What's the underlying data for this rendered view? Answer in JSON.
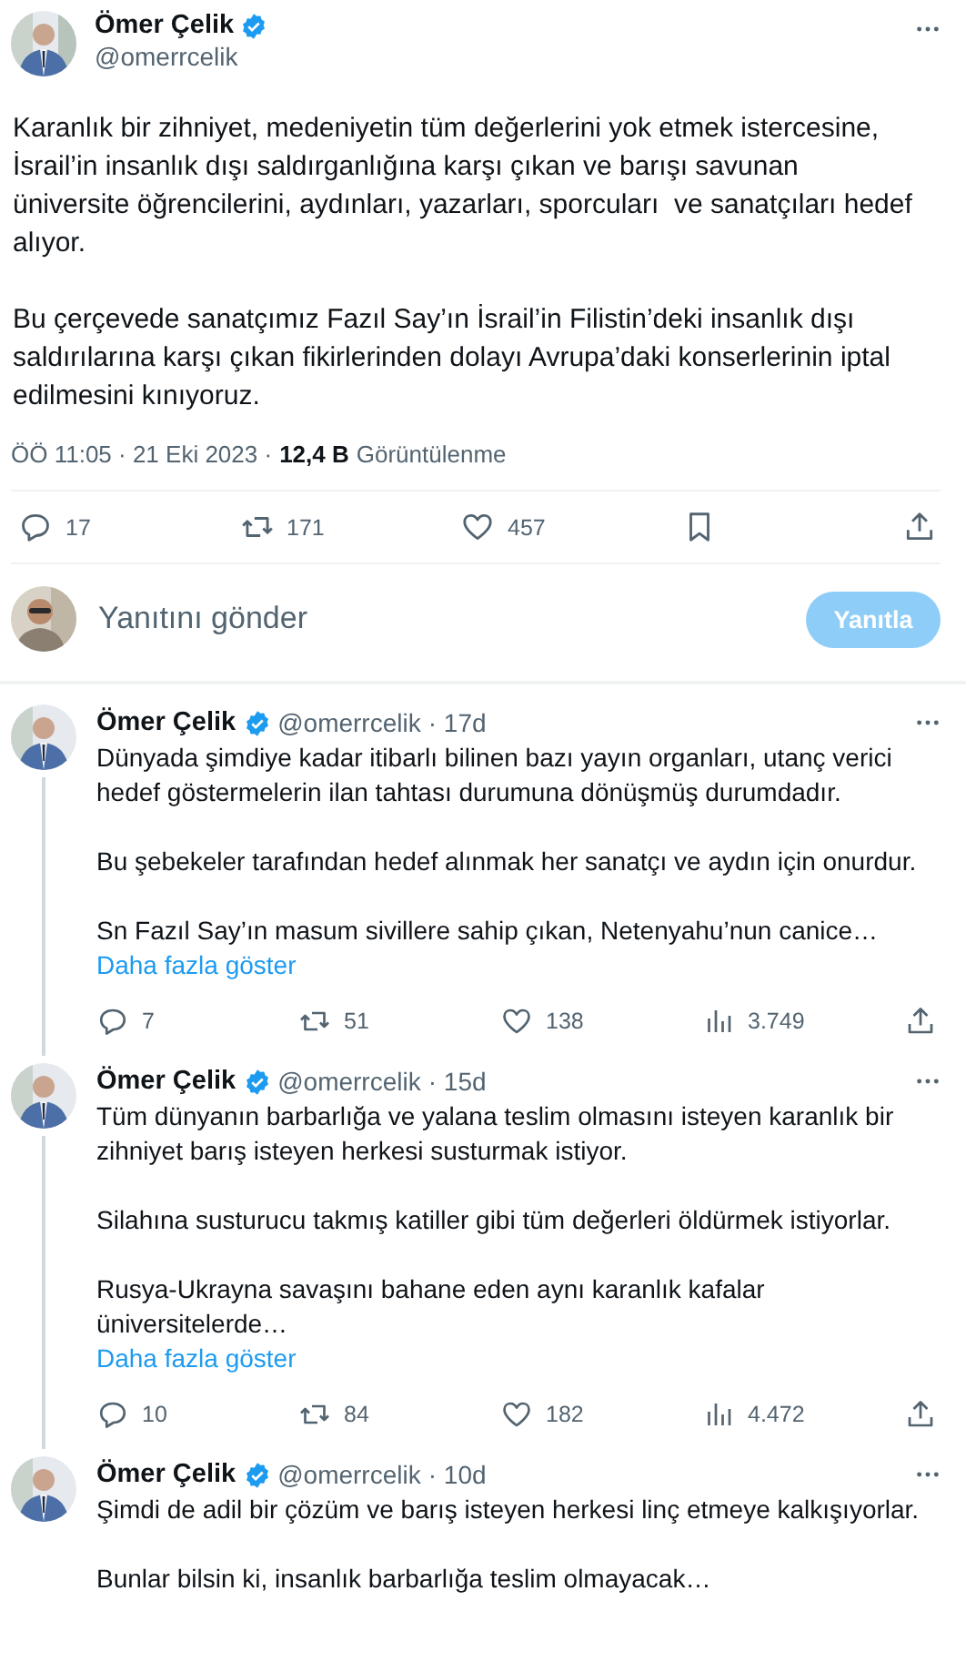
{
  "tweet": {
    "name": "Ömer Çelik",
    "verified": true,
    "handle": "@omerrcelik",
    "paragraphs": [
      "Karanlık bir zihniyet, medeniyetin tüm değerlerini yok etmek istercesine, İsrail’in insanlık dışı saldırganlığına karşı çıkan ve barışı savunan üniversite öğrencilerini, aydınları, yazarları, sporcuları  ve sanatçıları hedef alıyor.",
      "Bu çerçevede sanatçımız Fazıl Say’ın İsrail’in Filistin’deki insanlık dışı saldırılarına karşı çıkan fikirlerinden dolayı Avrupa’daki konserlerinin iptal edilmesini kınıyoruz."
    ],
    "time": "ÖÖ 11:05 · 21 Eki 2023 ·",
    "views": "12,4 B",
    "views_label": "Görüntülenme",
    "actions": [
      {
        "kind": "reply",
        "count": "17"
      },
      {
        "kind": "retweet",
        "count": "171"
      },
      {
        "kind": "like",
        "count": "457"
      },
      {
        "kind": "bookmark"
      },
      {
        "kind": "share"
      }
    ]
  },
  "composer": {
    "placeholder": "Yanıtını gönder",
    "button": "Yanıtla",
    "disabled": true
  },
  "replies": [
    {
      "name": "Ömer Çelik",
      "verified": true,
      "handle": "@omerrcelik",
      "age": "· 17d",
      "thread_line": true,
      "paragraphs": [
        "Dünyada şimdiye kadar itibarlı bilinen bazı yayın organları, utanç verici hedef göstermelerin ilan tahtası durumuna dönüşmüş durumdadır.",
        "Bu şebekeler tarafından hedef alınmak her sanatçı ve aydın için onurdur.",
        "Sn Fazıl Say’ın masum sivillere sahip çıkan, Netenyahu’nun canice…"
      ],
      "show_more": "Daha fazla göster",
      "actions": [
        {
          "kind": "reply",
          "count": "7"
        },
        {
          "kind": "retweet",
          "count": "51"
        },
        {
          "kind": "like",
          "count": "138"
        },
        {
          "kind": "views",
          "count": "3.749"
        },
        {
          "kind": "share"
        }
      ]
    },
    {
      "name": "Ömer Çelik",
      "verified": true,
      "handle": "@omerrcelik",
      "age": "· 15d",
      "thread_line": true,
      "paragraphs": [
        "Tüm dünyanın barbarlığa ve yalana teslim olmasını isteyen karanlık bir zihniyet barış isteyen herkesi susturmak istiyor.",
        "Silahına susturucu takmış katiller gibi tüm değerleri öldürmek istiyorlar.",
        "Rusya-Ukrayna savaşını bahane eden aynı karanlık kafalar üniversitelerde…"
      ],
      "show_more": "Daha fazla göster",
      "actions": [
        {
          "kind": "reply",
          "count": "10"
        },
        {
          "kind": "retweet",
          "count": "84"
        },
        {
          "kind": "like",
          "count": "182"
        },
        {
          "kind": "views",
          "count": "4.472"
        },
        {
          "kind": "share"
        }
      ]
    },
    {
      "name": "Ömer Çelik",
      "verified": true,
      "handle": "@omerrcelik",
      "age": "· 10d",
      "thread_line": false,
      "paragraphs": [
        "Şimdi de adil bir çözüm ve barış isteyen herkesi linç etmeye kalkışıyorlar.",
        "Bunlar bilsin ki, insanlık barbarlığa teslim olmayacak…"
      ]
    }
  ]
}
